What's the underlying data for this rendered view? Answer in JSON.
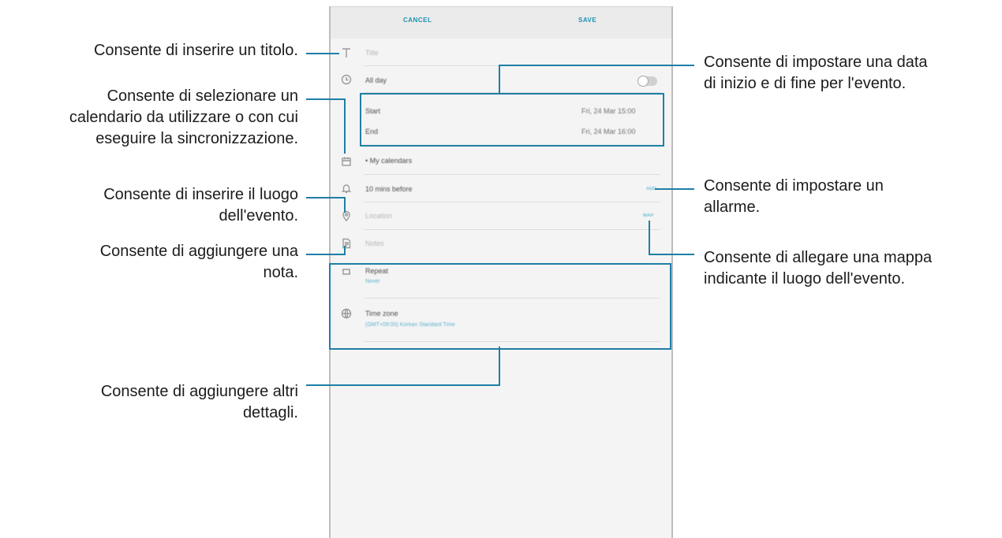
{
  "phone": {
    "cancel_label": "CANCEL",
    "save_label": "SAVE",
    "title_placeholder": "Title",
    "all_day_label": "All day",
    "all_day_on": false,
    "start_label": "Start",
    "start_value": "Fri, 24 Mar  15:00",
    "end_label": "End",
    "end_value": "Fri, 24 Mar  16:00",
    "calendar_label": "My calendars",
    "reminder_label": "10 mins before",
    "reminder_action": "ADD",
    "location_placeholder": "Location",
    "location_action": "MAP",
    "notes_placeholder": "Notes",
    "repeat_label": "Repeat",
    "repeat_value": "Never",
    "timezone_label": "Time zone",
    "timezone_value": "(GMT+09:00) Korean Standard Time"
  },
  "callouts": {
    "title": [
      "Consente di inserire un titolo."
    ],
    "calendar": [
      "Consente di selezionare un",
      "calendario da utilizzare o con cui",
      "eseguire la sincronizzazione."
    ],
    "location": [
      "Consente di inserire il luogo",
      "dell'evento."
    ],
    "note": [
      "Consente di aggiungere una",
      "nota."
    ],
    "details": [
      "Consente di aggiungere altri",
      "dettagli."
    ],
    "date": [
      "Consente di impostare una data",
      "di inizio e di fine per l'evento."
    ],
    "alarm": [
      "Consente di impostare un",
      "allarme."
    ],
    "map": [
      "Consente di allegare una mappa",
      "indicante il luogo dell'evento."
    ]
  },
  "colors": {
    "accent": "#1f7fa6",
    "link_blue": "#1c8fb0"
  }
}
